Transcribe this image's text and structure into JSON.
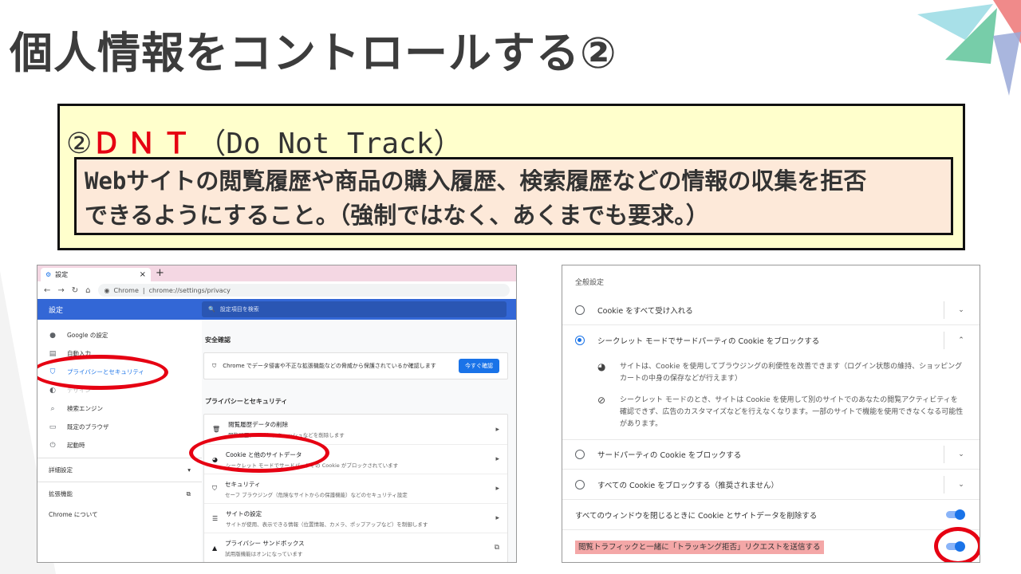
{
  "slide": {
    "title": "個人情報をコントロールする②",
    "heading_num": "②",
    "heading_abbr": "ＤＮＴ",
    "heading_full": "（Do Not Track）",
    "definition_line1": "Webサイトの閲覧履歴や商品の購入履歴、検索履歴などの情報の収集を拒否",
    "definition_line2": "できるようにすること。（強制ではなく、あくまでも要求。）"
  },
  "browser": {
    "tab_title": "設定",
    "tab_close": "×",
    "new_tab": "+",
    "omnibox_site": "Chrome",
    "omnibox_url": "chrome://settings/privacy",
    "header_title": "設定",
    "search_placeholder": "設定項目を検索"
  },
  "sidebar": {
    "items": [
      {
        "label": "Google の設定"
      },
      {
        "label": "自動入力"
      },
      {
        "label": "プライバシーとセキュリティ"
      },
      {
        "label": "デザイン"
      },
      {
        "label": "検索エンジン"
      },
      {
        "label": "既定のブラウザ"
      },
      {
        "label": "起動時"
      }
    ],
    "advanced": "詳細設定",
    "extensions": "拡張機能",
    "about": "Chrome について"
  },
  "main": {
    "safety_title": "安全確認",
    "safety_text": "Chrome でデータ侵害や不正な拡張機能などの脅威から保護されているか確認します",
    "safety_button": "今すぐ確認",
    "privacy_title": "プライバシーとセキュリティ",
    "rows": [
      {
        "title": "閲覧履歴データの削除",
        "desc": "閲覧履歴、Cookie、キャッシュなどを削除します"
      },
      {
        "title": "Cookie と他のサイトデータ",
        "desc": "シークレット モードでサードパーティの Cookie がブロックされています"
      },
      {
        "title": "セキュリティ",
        "desc": "セーフ ブラウジング（危険なサイトからの保護機能）などのセキュリティ設定"
      },
      {
        "title": "サイトの設定",
        "desc": "サイトが使用、表示できる情報（位置情報、カメラ、ポップアップなど）を制御します"
      },
      {
        "title": "プライバシー サンドボックス",
        "desc": "試用版機能はオンになっています"
      }
    ]
  },
  "cookies": {
    "general": "全般設定",
    "options": [
      {
        "label": "Cookie をすべて受け入れる"
      },
      {
        "label": "シークレット モードでサードパーティの Cookie をブロックする"
      },
      {
        "label": "サードパーティの Cookie をブロックする"
      },
      {
        "label": "すべての Cookie をブロックする（推奨されません）"
      }
    ],
    "detail1": "サイトは、Cookie を使用してブラウジングの利便性を改善できます（ログイン状態の維持、ショッピング カートの中身の保存などが行えます）",
    "detail2": "シークレット モードのとき、サイトは Cookie を使用して別のサイトでのあなたの閲覧アクティビティを確認できず、広告のカスタマイズなどを行えなくなります。一部のサイトで機能を使用できなくなる可能性があります。",
    "clear_on_exit": "すべてのウィンドウを閉じるときに Cookie とサイトデータを削除する",
    "dnt": "閲覧トラフィックと一緒に「トラッキング拒否」リクエストを送信する"
  }
}
